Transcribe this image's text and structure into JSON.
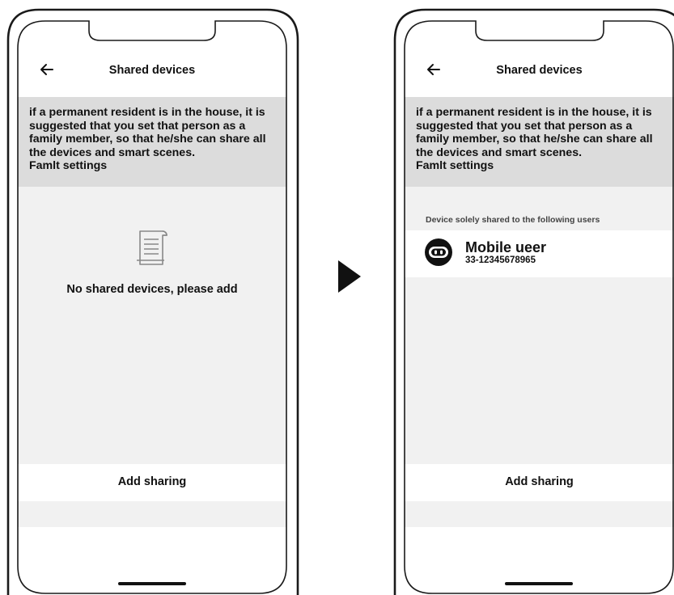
{
  "before": {
    "header": {
      "back_icon": "arrow-left-icon",
      "title": "Shared devices"
    },
    "notice": {
      "text": "if a permanent resident is in the house, it is suggested that you set that person as a family member, so that he/she can share all the devices and smart scenes.",
      "link_label": "Famlt settings"
    },
    "empty_state": {
      "icon": "document-scroll-icon",
      "text": "No shared devices, please add"
    },
    "add_button_label": "Add sharing"
  },
  "transition_icon": "play-arrow-icon",
  "after": {
    "header": {
      "back_icon": "arrow-left-icon",
      "title": "Shared devices"
    },
    "notice": {
      "text": "if a permanent resident is in the house, it is suggested that you set that person as a family member, so that he/she can share all the devices and smart scenes.",
      "link_label": "Famlt settings"
    },
    "section_label": "Device solely shared to the following users",
    "users": [
      {
        "avatar_icon": "robot-avatar-icon",
        "name": "Mobile ueer",
        "id": "33-12345678965"
      }
    ],
    "add_button_label": "Add sharing"
  }
}
